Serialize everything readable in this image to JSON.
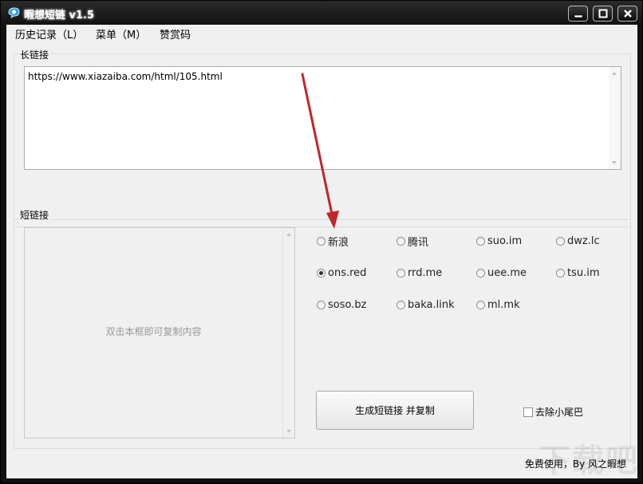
{
  "window": {
    "title": "暇想短链 v1.5"
  },
  "menu": {
    "items": [
      "历史记录（L）",
      "菜单（M）",
      "赞赏码"
    ]
  },
  "long_link": {
    "label": "长链接",
    "value": "https://www.xiazaiba.com/html/105.html"
  },
  "short_link": {
    "label": "短链接",
    "hint": "双击本框即可复制内容"
  },
  "services": [
    {
      "label": "新浪",
      "checked": false
    },
    {
      "label": "腾讯",
      "checked": false
    },
    {
      "label": "suo.im",
      "checked": false
    },
    {
      "label": "dwz.lc",
      "checked": false
    },
    {
      "label": "ons.red",
      "checked": true
    },
    {
      "label": "rrd.me",
      "checked": false
    },
    {
      "label": "uee.me",
      "checked": false
    },
    {
      "label": "tsu.im",
      "checked": false
    },
    {
      "label": "soso.bz",
      "checked": false
    },
    {
      "label": "baka.link",
      "checked": false
    },
    {
      "label": "ml.mk",
      "checked": false
    }
  ],
  "actions": {
    "generate_label": "生成短链接 并复制",
    "remove_tail_label": "去除小尾巴",
    "remove_tail_checked": false
  },
  "footer": {
    "text": "免费使用，By 风之暇想"
  },
  "watermark": "下载吧",
  "colors": {
    "annotation_arrow": "#c0262a",
    "titlebar": "#1a1a1a"
  }
}
